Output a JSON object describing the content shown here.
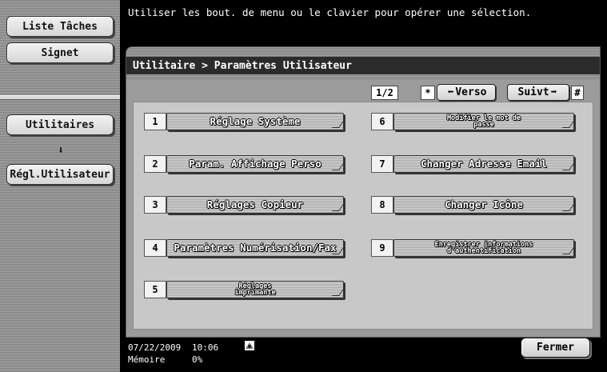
{
  "sidebar": {
    "job_list_label": "Liste Tâches",
    "bookmark_label": "Signet",
    "utilities_label": "Utilitaires",
    "down_arrow": "⬇",
    "user_settings_label": "Régl.Utilisateur"
  },
  "message": "Utiliser les bout. de menu ou le clavier pour opérer une sélection.",
  "panel": {
    "breadcrumb": "Utilitaire > Paramètres Utilisateur",
    "page_indicator": "1/2",
    "prev_key": "*",
    "prev_label": "Verso",
    "next_label": "Suivt",
    "next_key": "#",
    "prev_arrow": "⬅",
    "next_arrow": "➡"
  },
  "menu": [
    {
      "num": "1",
      "label": "Réglage Système"
    },
    {
      "num": "2",
      "label": "Param. Affichage Perso"
    },
    {
      "num": "3",
      "label": "Réglages Copieur"
    },
    {
      "num": "4",
      "label": "Paramètres Numérisation/Fax"
    },
    {
      "num": "5",
      "label": "Réglages imprimante"
    },
    {
      "num": "6",
      "label": "Modifier le mot de passe"
    },
    {
      "num": "7",
      "label": "Changer Adresse Email"
    },
    {
      "num": "8",
      "label": "Changer Icône"
    },
    {
      "num": "9",
      "label": "Enregistrer informations d'authentification"
    }
  ],
  "footer": {
    "date": "07/22/2009",
    "time": "10:06",
    "memory_label": "Mémoire",
    "memory_value": "0%",
    "close_label": "Fermer",
    "status_icon": "network-icon"
  }
}
